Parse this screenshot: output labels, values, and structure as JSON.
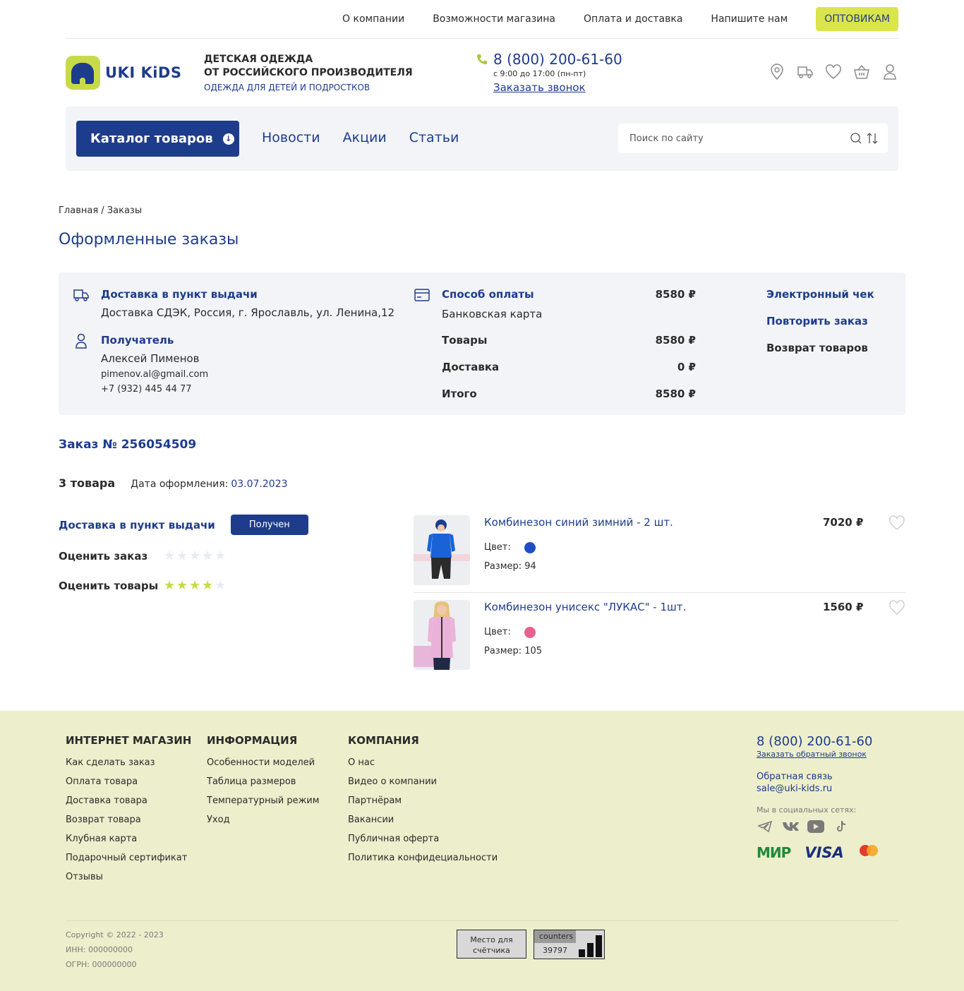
{
  "topnav": {
    "links": [
      "О компании",
      "Возможности магазина",
      "Оплата и доставка",
      "Напишите нам"
    ],
    "wholesale": "ОПТОВИКАМ"
  },
  "header": {
    "logo_text": "UKI KiDS",
    "tagline1": "ДЕТСКАЯ ОДЕЖДА",
    "tagline2": "ОТ РОССИЙСКОГО ПРОИЗВОДИТЕЛЯ",
    "tagline3": "ОДЕЖДА ДЛЯ ДЕТЕЙ И ПОДРОСТКОВ",
    "phone": "8 (800) 200-61-60",
    "hours": "с 9:00 до 17:00 (пн-пт)",
    "callback": "Заказать звонок",
    "icons": [
      "location-icon",
      "delivery-truck-icon",
      "favorites-heart-icon",
      "cart-basket-icon",
      "user-icon"
    ]
  },
  "nav": {
    "catalog": "Каталог товаров",
    "links": [
      "Новости",
      "Акции",
      "Статьи"
    ],
    "search_placeholder": "Поиск по сайту"
  },
  "breadcrumb": "Главная / Заказы",
  "page_title": "Оформленные заказы",
  "summary": {
    "delivery_label": "Доставка в пункт выдачи",
    "delivery_address": "Доставка СДЭК, Россия, г. Ярославль, ул. Ленина,12",
    "recipient_label": "Получатель",
    "recipient_name": "Алексей Пименов",
    "recipient_email": "pimenov.al@gmail.com",
    "recipient_phone": "+7 (932) 445 44 77",
    "payment_label": "Способ оплаты",
    "payment_total": "8580 ₽",
    "payment_method": "Банковская карта",
    "rows": [
      {
        "label": "Товары",
        "value": "8580 ₽"
      },
      {
        "label": "Доставка",
        "value": "0 ₽"
      },
      {
        "label": "Итого",
        "value": "8580 ₽"
      }
    ],
    "actions": {
      "receipt": "Электронный чек",
      "repeat": "Повторить заказ",
      "return": "Возврат товаров"
    }
  },
  "order": {
    "number": "Заказ № 256054509",
    "count": "3 товара",
    "date_label": "Дата оформления:",
    "date": "03.07.2023",
    "delivery_label": "Доставка в пункт выдачи",
    "status": "Получен",
    "rate_order_label": "Оценить заказ",
    "rate_order_stars": 0,
    "rate_goods_label": "Оценить товары",
    "rate_goods_stars": 4,
    "star_max": 5,
    "star_color_on": "#c8d94a",
    "star_color_off": "#e8ebf3"
  },
  "products": [
    {
      "name": "Комбинезон синий зимний - 2 шт.",
      "price": "7020 ₽",
      "color_label": "Цвет:",
      "color": "#1e4fc2",
      "size": "Размер: 94"
    },
    {
      "name": "Комбинезон унисекс \"ЛУКАС\" - 1шт.",
      "price": "1560 ₽",
      "color_label": "Цвет:",
      "color": "#e8608e",
      "size": "Размер: 105"
    }
  ],
  "footer": {
    "col1": {
      "title": "ИНТЕРНЕТ МАГАЗИН",
      "items": [
        "Как сделать заказ",
        "Оплата товара",
        "Доставка товара",
        "Возврат товара",
        "Клубная карта",
        "Подарочный сертификат",
        "Отзывы"
      ]
    },
    "col2": {
      "title": "ИНФОРМАЦИЯ",
      "items": [
        "Особенности моделей",
        "Таблица размеров",
        "Температурный режим",
        "Уход"
      ]
    },
    "col3": {
      "title": "КОМПАНИЯ",
      "items": [
        "О нас",
        "Видео о компании",
        "Партнёрам",
        "Вакансии",
        "Публичная оферта",
        "Политика конфидециальности"
      ]
    },
    "phone": "8 (800) 200-61-60",
    "callback": "Заказать обратный звонок",
    "feedback": "Обратная связь",
    "email": "sale@uki-kids.ru",
    "social_label": "Мы в социальных сетях:",
    "socials": [
      "telegram-icon",
      "vk-icon",
      "youtube-icon",
      "tiktok-icon"
    ],
    "payments": [
      "МИР",
      "VISA",
      "mastercard"
    ],
    "copyright": "Copyright © 2022 - 2023",
    "inn": "ИНН: 000000000",
    "ogrn": "ОГРН: 000000000",
    "counter_placeholder": "Место для счётчика",
    "counter_label": "counters",
    "counter_value": "39797"
  },
  "colors": {
    "brand_blue": "#1e3c8c",
    "accent_lime": "#d9e54a",
    "footer_bg": "#edeecb",
    "panel_bg": "#f3f4f8"
  }
}
